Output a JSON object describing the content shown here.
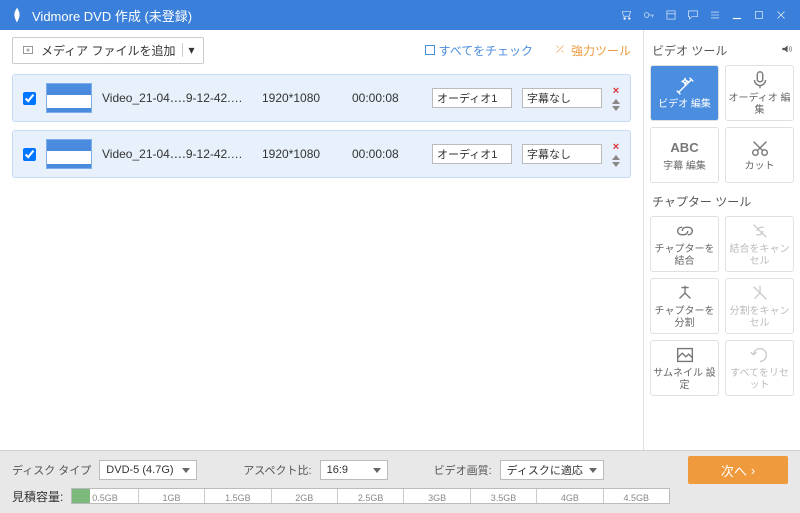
{
  "titlebar": {
    "title": "Vidmore DVD 作成 (未登録)"
  },
  "toolbar": {
    "add_label": "メディア ファイルを追加",
    "check_all": "すべてをチェック",
    "power_tool": "強力ツール"
  },
  "files": [
    {
      "name": "Video_21-04‥‥9-12-42.mp4",
      "resolution": "1920*1080",
      "duration": "00:00:08",
      "audio": "オーディオ1",
      "subtitle": "字幕なし"
    },
    {
      "name": "Video_21-04‥‥9-12-42.mp4",
      "resolution": "1920*1080",
      "duration": "00:00:08",
      "audio": "オーディオ1",
      "subtitle": "字幕なし"
    }
  ],
  "side": {
    "video_tools": "ビデオ ツール",
    "chapter_tools": "チャプター ツール",
    "tools": {
      "video_edit": "ビデオ 編集",
      "audio_edit": "オーディオ 編集",
      "subtitle_edit": "字幕 編集",
      "cut": "カット",
      "abc": "ABC",
      "merge_chapter": "チャプターを結合",
      "cancel_merge": "結合をキャンセル",
      "split_chapter": "チャプターを分割",
      "cancel_split": "分割をキャンセル",
      "thumbnail": "サムネイル 設定",
      "reset_all": "すべてをリセット"
    }
  },
  "bottom": {
    "disc_type_label": "ディスク タイプ",
    "disc_type_value": "DVD-5 (4.7G)",
    "aspect_label": "アスペクト比:",
    "aspect_value": "16:9",
    "quality_label": "ビデオ画質:",
    "quality_value": "ディスクに適応",
    "capacity_label": "見積容量:",
    "next": "次へ",
    "ticks": [
      "0.5GB",
      "1GB",
      "1.5GB",
      "2GB",
      "2.5GB",
      "3GB",
      "3.5GB",
      "4GB",
      "4.5GB"
    ]
  }
}
